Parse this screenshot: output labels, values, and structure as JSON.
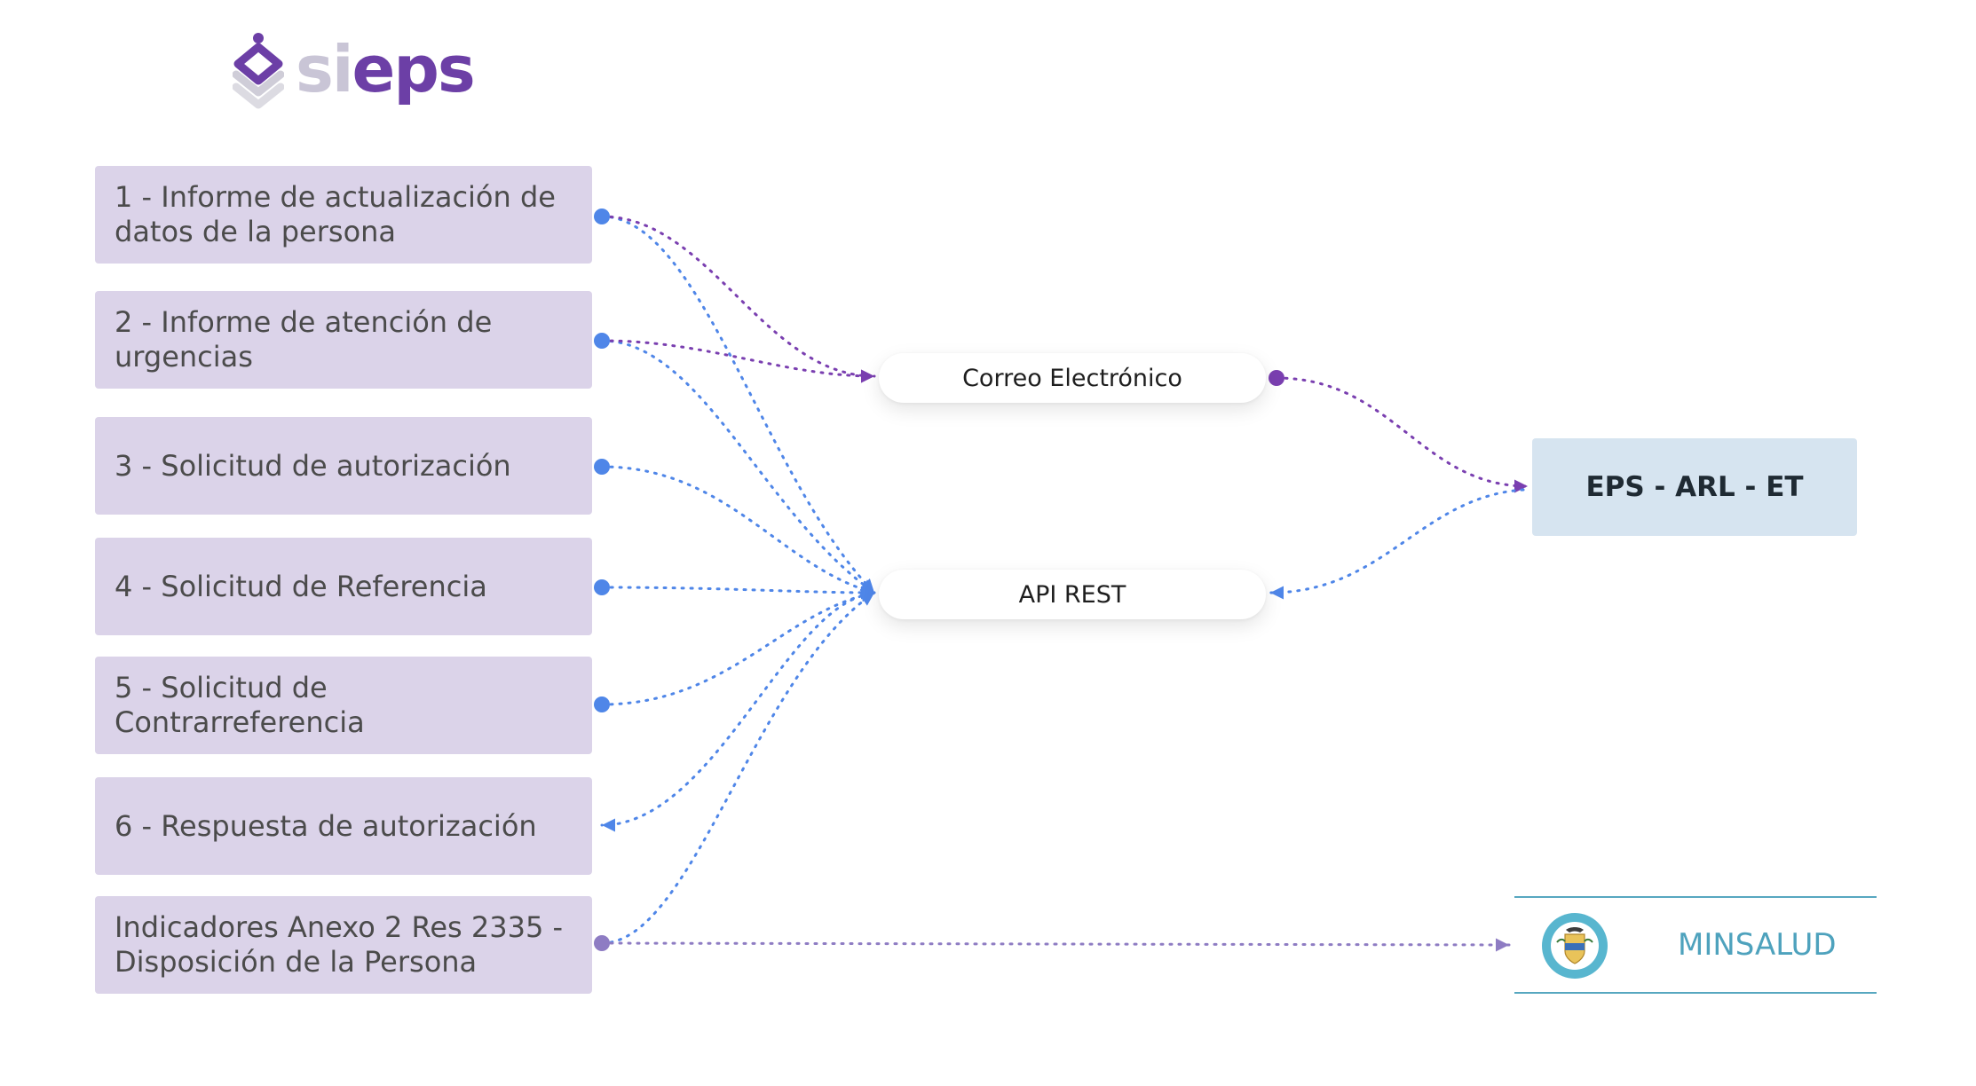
{
  "logo": {
    "part1": "si",
    "part2": "eps"
  },
  "items": [
    {
      "label": "1 - Informe de actualización de\ndatos de la persona"
    },
    {
      "label": "2 - Informe de atención de\nurgencias"
    },
    {
      "label": "3 - Solicitud de autorización"
    },
    {
      "label": "4 - Solicitud de Referencia"
    },
    {
      "label": "5 - Solicitud de\nContrarreferencia"
    },
    {
      "label": "6 - Respuesta de autorización"
    },
    {
      "label": "Indicadores Anexo 2 Res 2335 -\nDisposición de la Persona"
    }
  ],
  "channels": {
    "email": "Correo Electrónico",
    "api": "API REST"
  },
  "target": {
    "label": "EPS - ARL - ET"
  },
  "minsalud": {
    "label": "MINSALUD"
  },
  "colors": {
    "item_bg": "#dbd3e9",
    "purple": "#7a3fb0",
    "blue": "#4f86e8",
    "lavender": "#8e7cc3",
    "target_bg": "#d6e4f0",
    "minsalud": "#4ea2bd"
  }
}
